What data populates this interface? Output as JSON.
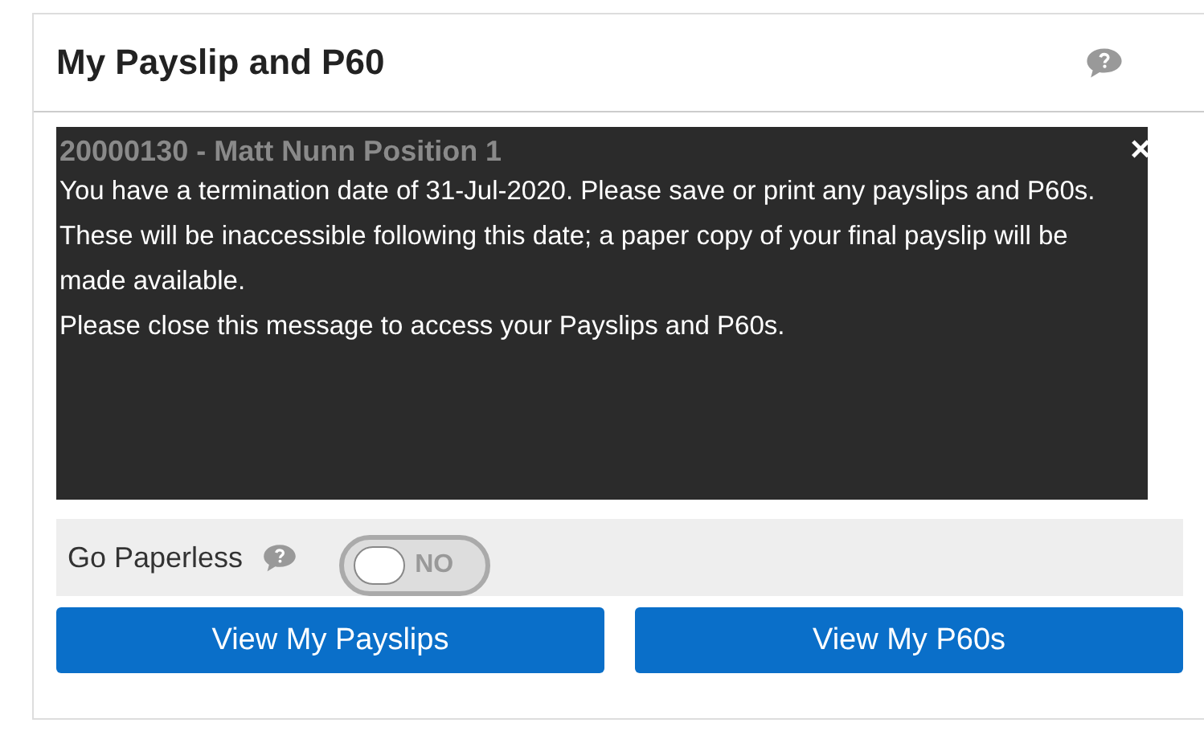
{
  "card": {
    "title": "My Payslip and P60"
  },
  "message": {
    "heading": "20000130 - Matt Nunn Position 1",
    "close": "×",
    "lines": [
      "You have a termination date of 31-Jul-2020. Please save or print any payslips and P60s. These will be inaccessible following this date; a paper copy of your final payslip will be made available.",
      "Please close this message to access your Payslips and P60s."
    ]
  },
  "paperless": {
    "label": "Go Paperless",
    "on": false,
    "state_text": "NO"
  },
  "buttons": [
    "View My Payslips",
    "View My P60s"
  ]
}
